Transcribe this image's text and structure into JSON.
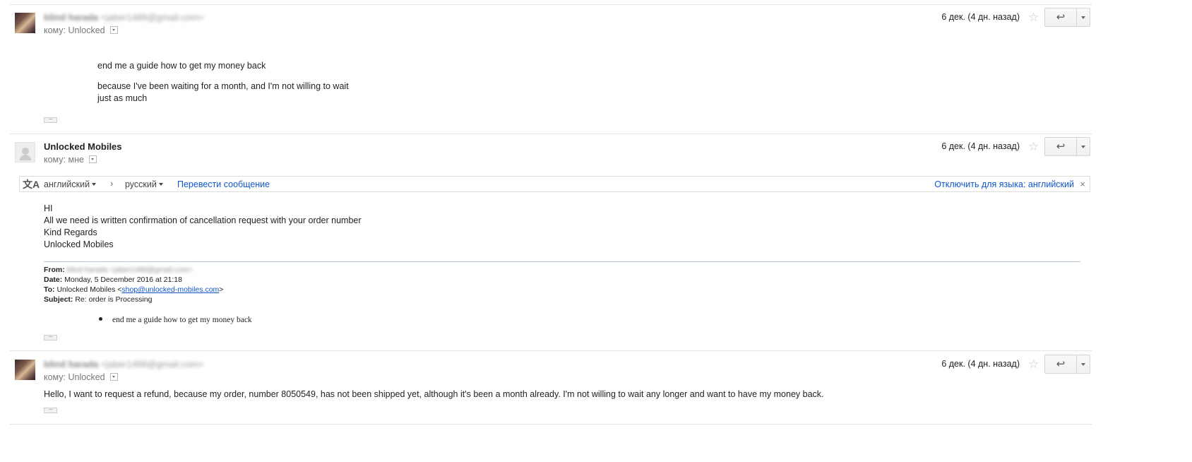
{
  "messages": [
    {
      "sender_name": "blind harada",
      "sender_email": "<jaber1488@gmail.com>",
      "to_label": "кому:",
      "to_value": "Unlocked",
      "date": "6 дек. (4 дн. назад)",
      "body_lines": [
        "end me a guide how to get my money back",
        "because I've been waiting for a month, and I'm not willing to wait",
        "just as much"
      ]
    },
    {
      "sender_name": "Unlocked Mobiles",
      "to_label": "кому:",
      "to_value": "мне",
      "date": "6 дек. (4 дн. назад)",
      "translate": {
        "from_lang": "английский",
        "to_lang": "русский",
        "translate_link": "Перевести сообщение",
        "disable_link": "Отключить для языка: английский"
      },
      "body_lines": [
        "HI",
        "All we need is written confirmation of cancellation request with your order number",
        "Kind Regards",
        "Unlocked Mobiles"
      ],
      "forwarded": {
        "from_label": "From:",
        "from_value": "blind harada <jaber1488@gmail.com>",
        "date_label": "Date:",
        "date_value": "Monday, 5 December 2016 at 21:18",
        "to_label": "To:",
        "to_value": "Unlocked Mobiles <",
        "to_email": "shop@unlocked-mobiles.com",
        "to_close": ">",
        "subject_label": "Subject:",
        "subject_value": "Re: order is Processing",
        "bullet": "end me a guide how to get my money back"
      }
    },
    {
      "sender_name": "blind harada",
      "sender_email": "<jaber1488@gmail.com>",
      "to_label": "кому:",
      "to_value": "Unlocked",
      "date": "6 дек. (4 дн. назад)",
      "body_lines": [
        "Hello, I want to request a refund, because my order, number 8050549, has not been shipped yet, although it's been a month already. I'm not willing to wait any longer and want to have my money back."
      ]
    }
  ],
  "icons": {
    "star": "☆",
    "reply": "↩",
    "translate": "文A",
    "close": "×",
    "ellipsis": "···",
    "arrow": "›"
  }
}
